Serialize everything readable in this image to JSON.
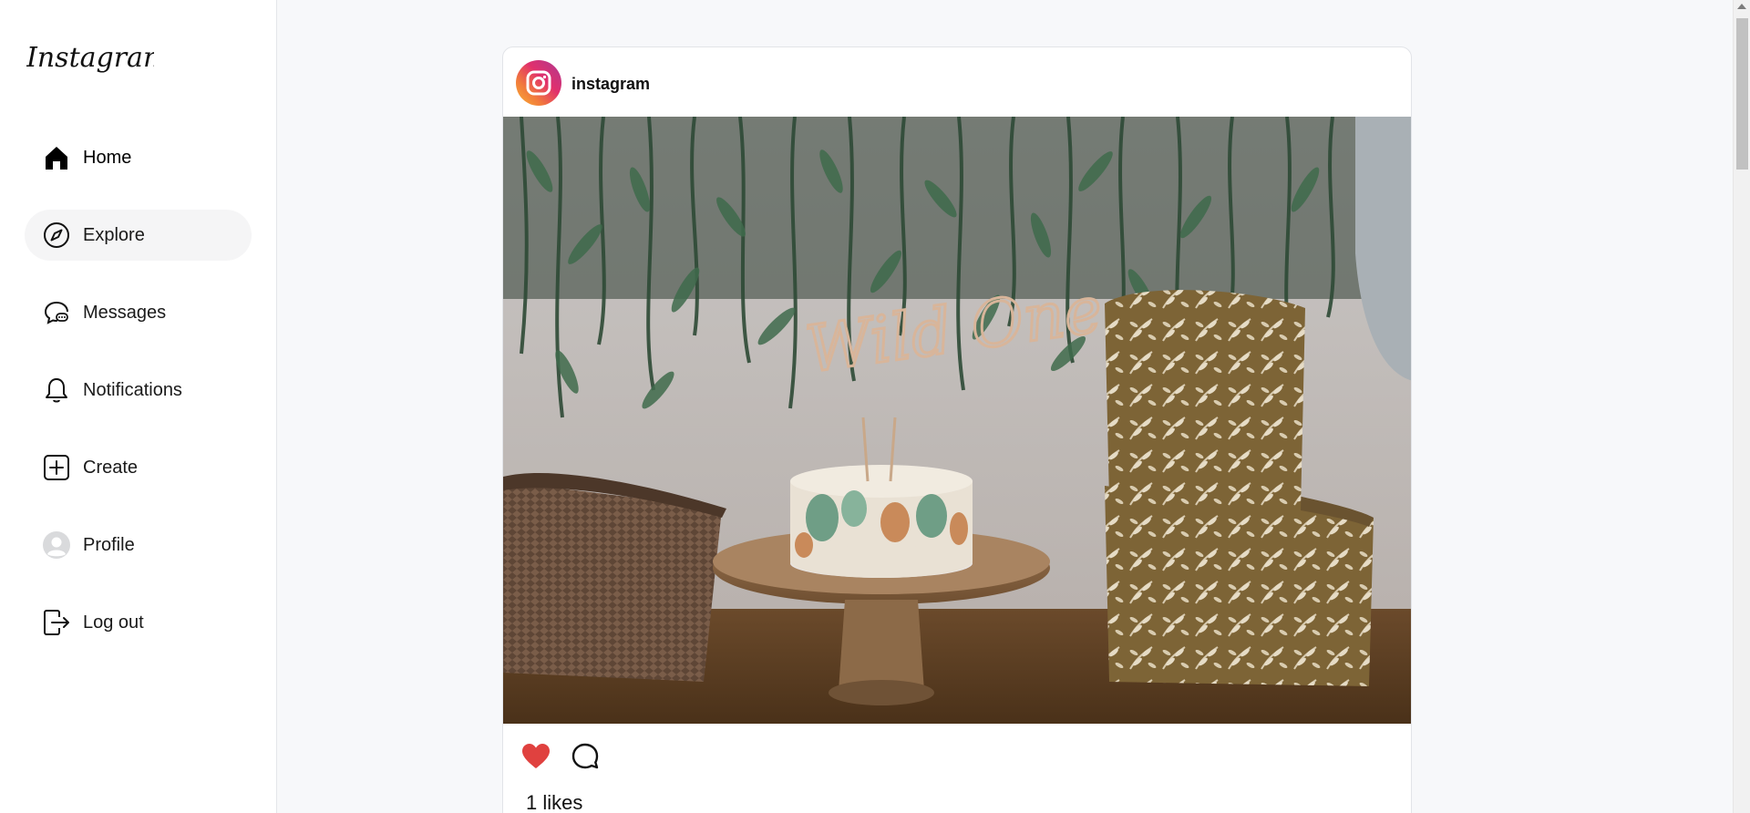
{
  "sidebar": {
    "logo_text": "Instagram",
    "items": [
      {
        "label": "Home",
        "icon": "home-icon",
        "active": false
      },
      {
        "label": "Explore",
        "icon": "compass-icon",
        "active": true
      },
      {
        "label": "Messages",
        "icon": "chat-bubble-icon",
        "active": false
      },
      {
        "label": "Notifications",
        "icon": "bell-icon",
        "active": false
      },
      {
        "label": "Create",
        "icon": "plus-square-icon",
        "active": false
      },
      {
        "label": "Profile",
        "icon": "profile-avatar-icon",
        "active": false
      },
      {
        "label": "Log out",
        "icon": "logout-icon",
        "active": false
      }
    ]
  },
  "post": {
    "username": "instagram",
    "likes_text": "1 likes",
    "liked": true,
    "image": {
      "cake_topper_text": "Wild One"
    }
  },
  "colors": {
    "background": "#f7f8fa",
    "sidebar": "#ffffff",
    "active_item": "#f5f5f6",
    "like_red": "#e0413f"
  }
}
